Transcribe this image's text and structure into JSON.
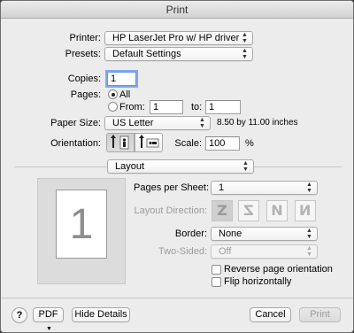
{
  "window": {
    "title": "Print"
  },
  "printer": {
    "label": "Printer:",
    "value": "HP LaserJet Pro w/ HP driver"
  },
  "presets": {
    "label": "Presets:",
    "value": "Default Settings"
  },
  "copies": {
    "label": "Copies:",
    "value": "1"
  },
  "pages": {
    "label": "Pages:",
    "all_label": "All",
    "from_label": "From:",
    "from_value": "1",
    "to_label": "to:",
    "to_value": "1"
  },
  "paper_size": {
    "label": "Paper Size:",
    "value": "US Letter",
    "dims": "8.50 by 11.00 inches"
  },
  "orientation": {
    "label": "Orientation:"
  },
  "scale": {
    "label": "Scale:",
    "value": "100",
    "unit": "%"
  },
  "section": {
    "value": "Layout"
  },
  "preview": {
    "page_number": "1"
  },
  "layout": {
    "pages_per_sheet": {
      "label": "Pages per Sheet:",
      "value": "1"
    },
    "direction": {
      "label": "Layout Direction:",
      "glyphs": [
        "Z",
        "Z",
        "N",
        "N"
      ]
    },
    "border": {
      "label": "Border:",
      "value": "None"
    },
    "two_sided": {
      "label": "Two-Sided:",
      "value": "Off"
    },
    "reverse": {
      "label": "Reverse page orientation"
    },
    "flip": {
      "label": "Flip horizontally"
    }
  },
  "footer": {
    "help": "?",
    "pdf": "PDF",
    "hide_details": "Hide Details",
    "cancel": "Cancel",
    "print": "Print"
  }
}
